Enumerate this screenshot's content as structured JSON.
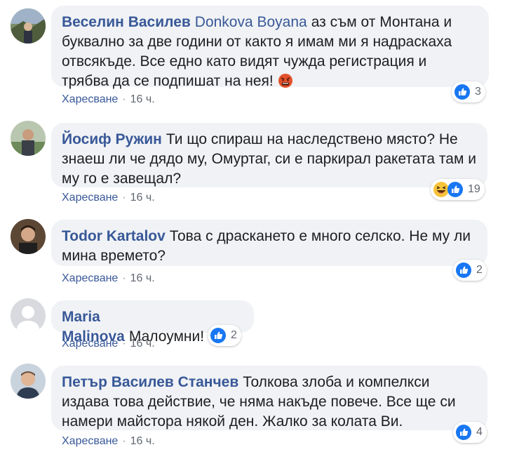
{
  "like_label": "Харесване",
  "separator": "·",
  "comments": [
    {
      "author": "Веселин Василев",
      "mention": "Donkova Boyana",
      "text": "аз съм от Монтана и буквално за две години от както я имам ми я надраскаха отвсякъде. Все едно като видят чужда регистрация и трябва да се подпишат на нея!",
      "emoji": "angry-face-icon",
      "time": "16 ч.",
      "reaction_count": "3"
    },
    {
      "author": "Йосиф Ружин",
      "text": "Ти що спираш на наследствено място? Не знаеш ли че дядо му, Омуртаг, си е паркирал ракетата там и му го е завещал?",
      "time": "16 ч.",
      "reaction_count": "19"
    },
    {
      "author": "Todor Kartalov",
      "text": "Това с драскането е много селско. Не му ли мина времето?",
      "time": "16 ч.",
      "reaction_count": "2"
    },
    {
      "author": "Maria Malinova",
      "text": "Малоумни!",
      "time": "16 ч.",
      "reaction_count": "2"
    },
    {
      "author": "Петър Василев Станчев",
      "text": "Толкова злоба и компелкси издава това действие, че няма накъде повече. Все ще си намери майстора някой ден. Жалко за колата Ви.",
      "time": "16 ч.",
      "reaction_count": "4"
    }
  ],
  "colors": {
    "link": "#385898",
    "bubble": "#f0f2f5",
    "like_blue": "#1877f2",
    "meta": "#606770"
  }
}
